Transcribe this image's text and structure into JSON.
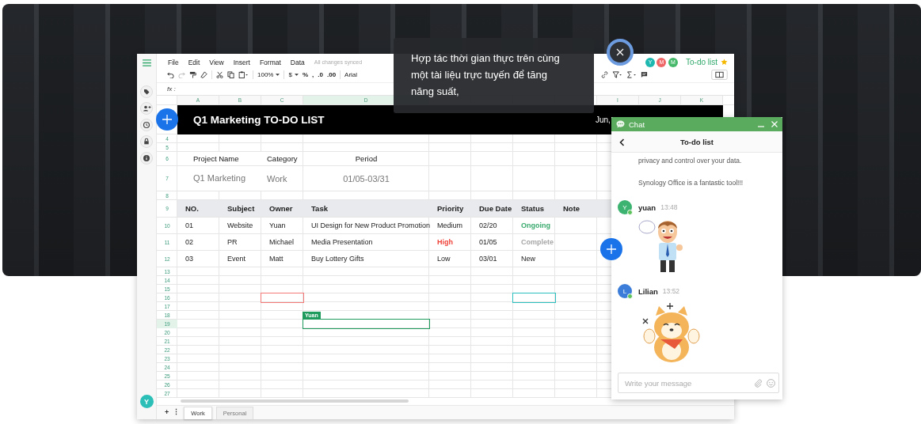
{
  "app": {
    "menu": [
      "File",
      "Edit",
      "View",
      "Insert",
      "Format",
      "Data"
    ],
    "sync_status": "All changes synced",
    "toolbar": {
      "zoom": "100%",
      "currency": "$",
      "percent": "%",
      "thousands": ",",
      "decimal_decrease": ".0",
      "decimal_increase": ".00",
      "font": "Arial"
    },
    "collaborators": [
      {
        "initial": "Y",
        "color": "#1fb8b0"
      },
      {
        "initial": "M",
        "color": "#ef6666"
      },
      {
        "initial": "M",
        "color": "#45b86a"
      }
    ],
    "doc_title": "To-do list",
    "starred": true,
    "formula_label": "fx :",
    "columns": [
      {
        "label": "A",
        "selected": false
      },
      {
        "label": "B",
        "selected": false
      },
      {
        "label": "C",
        "selected": false
      },
      {
        "label": "D",
        "selected": true
      },
      {},
      {},
      {},
      {},
      {
        "label": "I",
        "selected": false
      },
      {
        "label": "J",
        "selected": false
      },
      {
        "label": "K",
        "selected": false
      }
    ],
    "title": "Q1 Marketing TO-DO LIST",
    "title_date": "Jun,",
    "rows": [
      {
        "number": "4",
        "selected": false,
        "kind": "blank"
      },
      {
        "number": "5",
        "selected": false,
        "kind": "blank"
      },
      {
        "number": "6",
        "selected": false,
        "kind": "fields",
        "cells": [
          "Project Name",
          "Category",
          "Period"
        ]
      },
      {
        "number": "7",
        "selected": false,
        "kind": "values",
        "cells": [
          "Q1 Marketing",
          "Work",
          "01/05-03/31"
        ]
      },
      {
        "number": "8",
        "selected": false,
        "kind": "blank"
      },
      {
        "number": "9",
        "selected": false,
        "kind": "header",
        "cells": [
          "NO.",
          "Subject",
          "Owner",
          "Task",
          "Priority",
          "Due Date",
          "Status",
          "Note"
        ]
      },
      {
        "number": "10",
        "selected": false,
        "kind": "record",
        "cells": [
          {
            "text": "01"
          },
          {
            "text": "Website"
          },
          {
            "text": "Yuan"
          },
          {
            "text": "UI Design for New Product Promotion"
          },
          {
            "text": "Medium"
          },
          {
            "text": "02/20"
          },
          {
            "text": "Ongoing",
            "color": "#3aaa6e"
          }
        ]
      },
      {
        "number": "11",
        "selected": false,
        "kind": "record",
        "cells": [
          {
            "text": "02"
          },
          {
            "text": "PR"
          },
          {
            "text": "Michael"
          },
          {
            "text": "Media Presentation"
          },
          {
            "text": "High",
            "color": "#f0433a"
          },
          {
            "text": "01/05"
          },
          {
            "text": "Complete",
            "color": "#a6a6a6"
          }
        ]
      },
      {
        "number": "12",
        "selected": false,
        "kind": "record",
        "cells": [
          {
            "text": "03"
          },
          {
            "text": "Event"
          },
          {
            "text": "Matt"
          },
          {
            "text": "Buy Lottery Gifts"
          },
          {
            "text": "Low"
          },
          {
            "text": "03/01"
          },
          {
            "text": "New"
          }
        ]
      },
      {
        "number": "13",
        "selected": false,
        "kind": "blank"
      },
      {
        "number": "14",
        "selected": false,
        "kind": "blank"
      },
      {
        "number": "15",
        "selected": false,
        "kind": "blank"
      },
      {
        "number": "16",
        "selected": false,
        "kind": "blank",
        "cells": [
          {},
          {},
          {
            "color": "#f47a7a"
          },
          {},
          {},
          {},
          {
            "color": "#2bbfc0"
          }
        ]
      },
      {
        "number": "17",
        "selected": false,
        "kind": "blank"
      },
      {
        "number": "18",
        "selected": false,
        "kind": "blank"
      },
      {
        "number": "19",
        "selected": true,
        "kind": "blank",
        "cells": [
          {},
          {},
          {},
          {
            "color": "#1e9a5c",
            "user": "Yuan"
          }
        ]
      },
      {
        "number": "20",
        "selected": false,
        "kind": "blank"
      },
      {
        "number": "21",
        "selected": false,
        "kind": "blank"
      },
      {
        "number": "22",
        "selected": false,
        "kind": "blank"
      },
      {
        "number": "23",
        "selected": false,
        "kind": "blank"
      },
      {
        "number": "24",
        "selected": false,
        "kind": "blank"
      },
      {
        "number": "25",
        "selected": false,
        "kind": "blank"
      },
      {
        "number": "26",
        "selected": false,
        "kind": "blank"
      },
      {
        "number": "27",
        "selected": false,
        "kind": "blank"
      }
    ],
    "sheet_tabs": [
      {
        "label": "Work",
        "selected": true
      },
      {
        "label": "Personal",
        "selected": false
      }
    ],
    "add_sheet": "+",
    "sheet_menu": "⋮",
    "user": {
      "initial": "Y",
      "color": "#2bbfb8"
    }
  },
  "chat": {
    "title": "Chat",
    "conversation": "To-do list",
    "messages": [
      {
        "kind": "text",
        "text": "privacy and control over your data."
      },
      {
        "kind": "text",
        "text": "Synology Office is a fantastic tool!!!"
      },
      {
        "kind": "sticker",
        "author": "yuan",
        "initial": "Y",
        "color": "#3cb370",
        "online": true,
        "time": "13:48"
      },
      {
        "kind": "sticker",
        "author": "Lilian",
        "initial": "L",
        "color": "#3b7dd8",
        "online": true,
        "time": "13:52"
      }
    ],
    "placeholder": "Write your message"
  },
  "tooltip": {
    "text": "Hợp tác thời gian thực trên cùng một tài liệu trực tuyến để tăng năng suất,"
  }
}
